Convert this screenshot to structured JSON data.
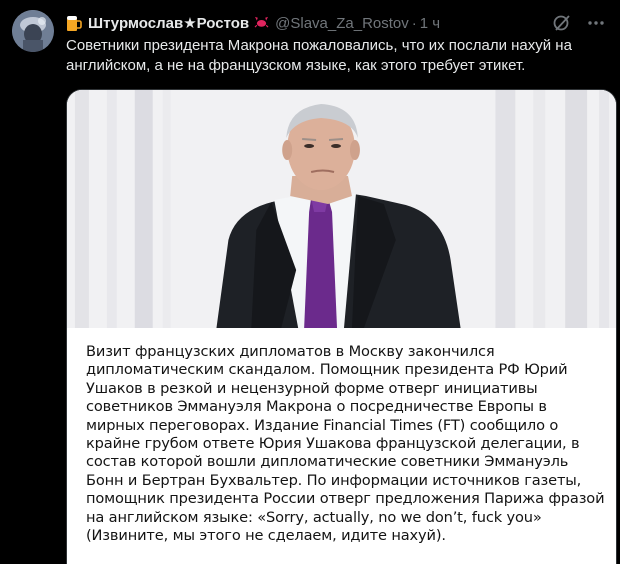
{
  "post": {
    "author": {
      "display_name": "Штурмослав★Ростов",
      "handle": "@Slava_Za_Rostov",
      "badge_icons": [
        "beer-mug-icon",
        "crab-icon"
      ]
    },
    "separator": "·",
    "time": "1 ч",
    "header_actions": [
      "grok-icon",
      "more-icon"
    ],
    "text": "Советники президента Макрона пожаловались, что их послали нахуй на английском, а не на французском языке, как этого требует этикет.",
    "media": {
      "caption": "Визит французских дипломатов в Москву закончился дипломатическим скандалом. Помощник президента РФ Юрий Ушаков в резкой и нецензурной форме отверг инициативы советников Эммануэля Макрона о посредничестве Европы в мирных переговорах. Издание Financial Times (FT) сообщило о крайне грубом ответе Юрия Ушакова французской делегации, в состав которой вошли дипломатические советники Эммануэль Бонн и Бертран Бухвальтер. По информации источников газеты, помощник президента России отверг предложения Парижа фразой на английском языке: «Sorry, actually, no we don’t, fuck you» (Извините, мы этого не сделаем, идите нахуй)."
    }
  },
  "colors": {
    "background": "#000000",
    "text_primary": "#e7e9ea",
    "text_secondary": "#71767b",
    "caption_bg": "#ffffff",
    "caption_text": "#141414",
    "tie": "#6b2a8c"
  }
}
